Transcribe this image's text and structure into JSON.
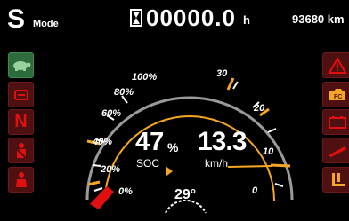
{
  "header": {
    "mode_letter": "S",
    "mode_word": "Mode",
    "hours_value": "00000.0",
    "hours_unit": "h",
    "odometer": "93680 km"
  },
  "left_indicators": [
    {
      "icon": "turtle-icon",
      "color": "#2d6b3d"
    },
    {
      "icon": "parking-brake-icon",
      "color": "#4e1010"
    },
    {
      "icon": "neutral-gear-icon",
      "label": "N",
      "color": "#4e1010"
    },
    {
      "icon": "seat-belt-icon",
      "color": "#4e1010"
    },
    {
      "icon": "seat-occupancy-icon",
      "color": "#4e1010"
    }
  ],
  "right_indicators": [
    {
      "icon": "warning-triangle-icon",
      "color": "#4e1010"
    },
    {
      "icon": "fault-code-icon",
      "label": "FC",
      "color": "#4e1010"
    },
    {
      "icon": "battery-icon",
      "color": "#4e1010"
    },
    {
      "icon": "temperature-warning-icon",
      "color": "#4e1010"
    },
    {
      "icon": "forks-icon",
      "color": "#4e1010"
    }
  ],
  "soc_gauge": {
    "ticks": [
      "100%",
      "80%",
      "60%",
      "40%",
      "20%",
      "0%"
    ],
    "value": 47,
    "value_text": "47",
    "unit": "%",
    "label": "SOC"
  },
  "speed_gauge": {
    "ticks": [
      "30",
      "20",
      "10",
      "0"
    ],
    "value": 13.3,
    "value_text": "13.3",
    "unit": "km/h"
  },
  "temperature": {
    "value": "29°"
  },
  "colors": {
    "accent": "#f5a623",
    "warning": "#e01010",
    "tile_red": "#4e1010",
    "tile_green": "#2d6b3d"
  }
}
